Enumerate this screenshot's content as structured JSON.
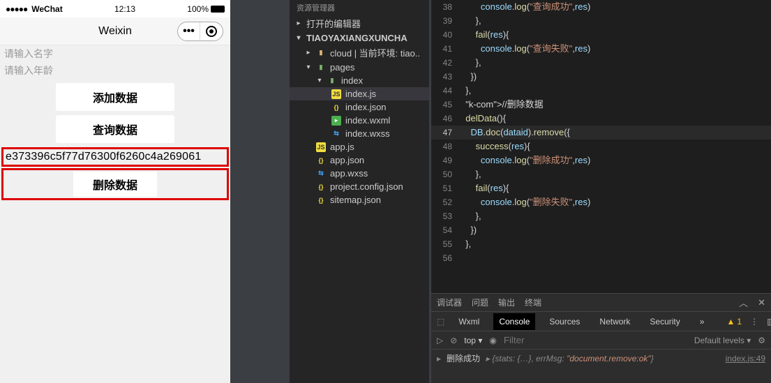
{
  "sim": {
    "carrier": "WeChat",
    "signal": "●●●●●",
    "time": "12:13",
    "battery": "100%",
    "title": "Weixin",
    "capsule_more": "•••",
    "placeholders": {
      "name": "请输入名字",
      "age": "请输入年龄"
    },
    "buttons": {
      "add": "添加数据",
      "query": "查询数据",
      "del": "删除数据"
    },
    "hash": "e373396c5f77d76300f6260c4a269061"
  },
  "explorer": {
    "header": "资源管理器",
    "open_editors": "打开的编辑器",
    "project": "TIAOYAXIANGXUNCHA",
    "cloud": "cloud | 当前环境: tiao..",
    "items": {
      "pages": "pages",
      "index": "index",
      "index_js": "index.js",
      "index_json": "index.json",
      "index_wxml": "index.wxml",
      "index_wxss": "index.wxss",
      "app_js": "app.js",
      "app_json": "app.json",
      "app_wxss": "app.wxss",
      "project_config": "project.config.json",
      "sitemap": "sitemap.json"
    }
  },
  "code": {
    "lines": [
      {
        "n": "38",
        "t": "        console.log(\"查询成功\",res)",
        "cls": "dim"
      },
      {
        "n": "39",
        "t": "      },"
      },
      {
        "n": "40",
        "t": "      fail(res){"
      },
      {
        "n": "41",
        "t": "        console.log(\"查询失败\",res)"
      },
      {
        "n": "42",
        "t": "      },"
      },
      {
        "n": "43",
        "t": "    })"
      },
      {
        "n": "44",
        "t": "  },"
      },
      {
        "n": "45",
        "t": "  //删除数据"
      },
      {
        "n": "46",
        "t": "  delData(){"
      },
      {
        "n": "47",
        "t": "    DB.doc(dataid).remove({",
        "hl": true
      },
      {
        "n": "48",
        "t": "      success(res){"
      },
      {
        "n": "49",
        "t": "        console.log(\"删除成功\",res)"
      },
      {
        "n": "50",
        "t": "      },"
      },
      {
        "n": "51",
        "t": "      fail(res){"
      },
      {
        "n": "52",
        "t": "        console.log(\"删除失败\",res)"
      },
      {
        "n": "53",
        "t": "      },"
      },
      {
        "n": "54",
        "t": "    })"
      },
      {
        "n": "55",
        "t": "  },"
      },
      {
        "n": "56",
        "t": ""
      }
    ]
  },
  "dev": {
    "tabs": {
      "debugger": "调试器",
      "problems": "问题",
      "output": "输出",
      "terminal": "终端"
    },
    "subtabs": {
      "wxml": "Wxml",
      "console": "Console",
      "sources": "Sources",
      "network": "Network",
      "security": "Security",
      "more": "»"
    },
    "warn_count": "1",
    "toolbar": {
      "top": "top",
      "filter_ph": "Filter",
      "levels": "Default levels ▾"
    },
    "log": {
      "label": "删除成功",
      "obj": "{stats: {…}, errMsg: \"document.remove:ok\"}",
      "src": "index.js:49"
    }
  }
}
